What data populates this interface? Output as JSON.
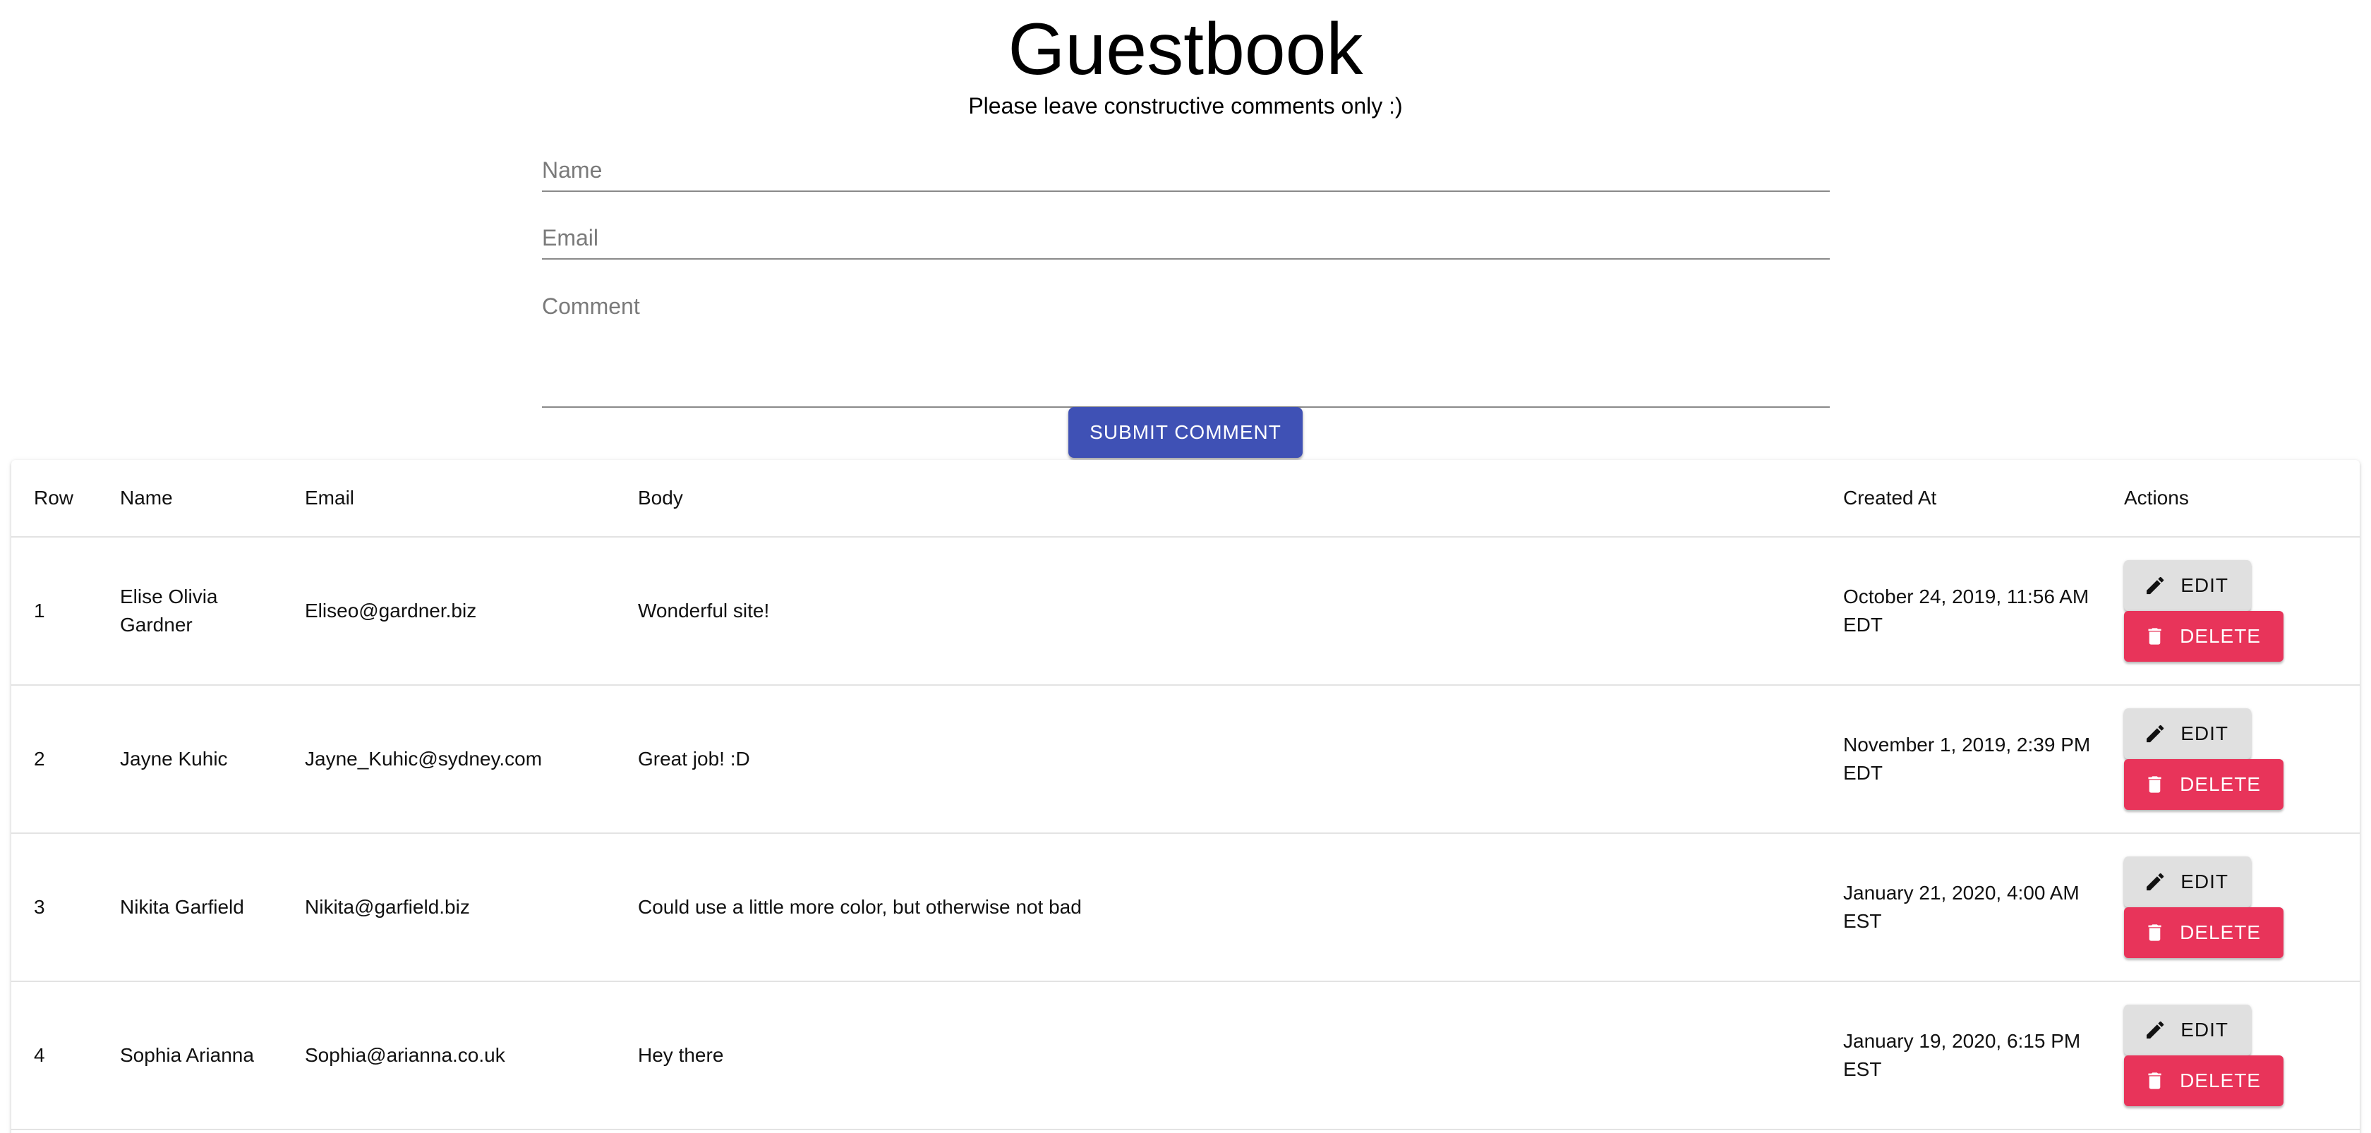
{
  "header": {
    "title": "Guestbook",
    "subtitle": "Please leave constructive comments only :)"
  },
  "form": {
    "name_placeholder": "Name",
    "email_placeholder": "Email",
    "comment_placeholder": "Comment",
    "name_value": "",
    "email_value": "",
    "comment_value": "",
    "submit_label": "SUBMIT COMMENT",
    "submit_color": "#3f51b5"
  },
  "table": {
    "headers": {
      "row": "Row",
      "name": "Name",
      "email": "Email",
      "body": "Body",
      "created_at": "Created At",
      "actions": "Actions"
    },
    "rows": [
      {
        "row": "1",
        "name": "Elise Olivia Gardner",
        "email": "Eliseo@gardner.biz",
        "body": "Wonderful site!",
        "created_at": "October 24, 2019, 11:56 AM EDT"
      },
      {
        "row": "2",
        "name": "Jayne Kuhic",
        "email": "Jayne_Kuhic@sydney.com",
        "body": "Great job! :D",
        "created_at": "November 1, 2019, 2:39 PM EDT"
      },
      {
        "row": "3",
        "name": "Nikita Garfield",
        "email": "Nikita@garfield.biz",
        "body": "Could use a little more color, but otherwise not bad",
        "created_at": "January 21, 2020, 4:00 AM EST"
      },
      {
        "row": "4",
        "name": "Sophia Arianna",
        "email": "Sophia@arianna.co.uk",
        "body": "Hey there",
        "created_at": "January 19, 2020, 6:15 PM EST"
      }
    ],
    "edit_label": "EDIT",
    "delete_label": "DELETE",
    "edit_icon": "pencil-icon",
    "delete_icon": "trash-icon",
    "delete_color": "#e8345a",
    "edit_color": "#e0e0e0"
  }
}
